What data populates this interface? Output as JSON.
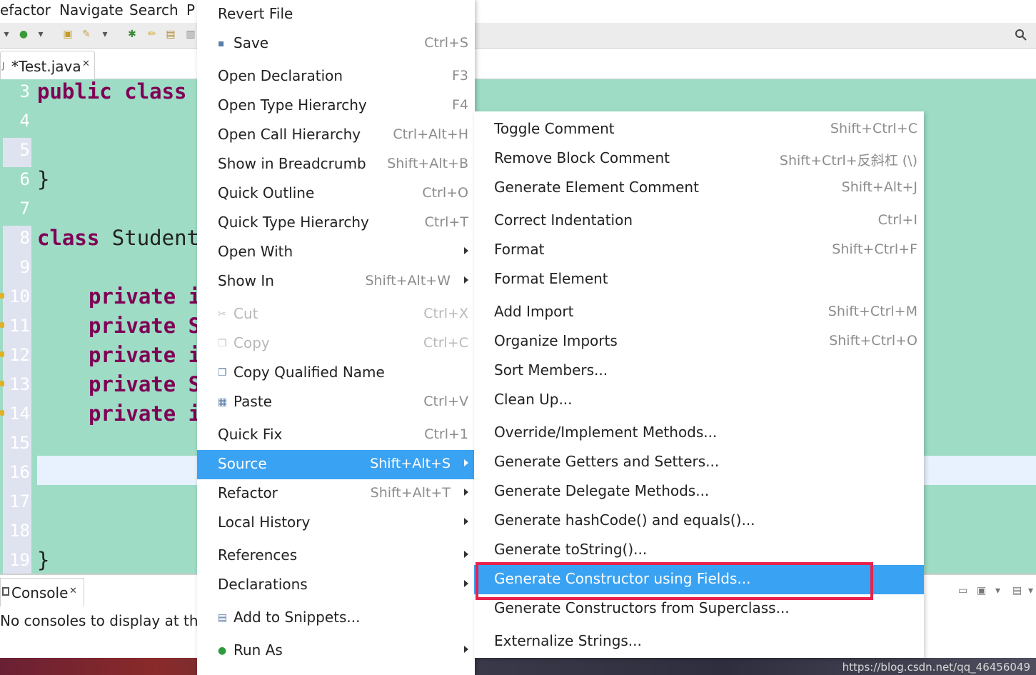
{
  "menubar": {
    "items": [
      "efactor",
      "Navigate",
      "Search",
      "P"
    ]
  },
  "toolbar": {
    "icons": [
      "dropdown-icon",
      "run-config-icon",
      "open-folder-icon",
      "wand-icon",
      "debug-icon",
      "pen-icon",
      "task-icon",
      "page-icon",
      "search-icon"
    ]
  },
  "editor": {
    "tab_title": "*Test.java",
    "lines": [
      {
        "num": "3",
        "text": "public class"
      },
      {
        "num": "4",
        "text": ""
      },
      {
        "num": "5",
        "text": ""
      },
      {
        "num": "6",
        "text": "}"
      },
      {
        "num": "7",
        "text": ""
      },
      {
        "num": "8",
        "text": "class Student"
      },
      {
        "num": "9",
        "text": ""
      },
      {
        "num": "10",
        "text": "private i"
      },
      {
        "num": "11",
        "text": "private S"
      },
      {
        "num": "12",
        "text": "private i"
      },
      {
        "num": "13",
        "text": "private S"
      },
      {
        "num": "14",
        "text": "private i"
      },
      {
        "num": "15",
        "text": ""
      },
      {
        "num": "16",
        "text": ""
      },
      {
        "num": "17",
        "text": ""
      },
      {
        "num": "18",
        "text": ""
      },
      {
        "num": "19",
        "text": "}"
      }
    ]
  },
  "console": {
    "tab_label": "Console",
    "message": "No consoles to display at this ti"
  },
  "context_menu": {
    "items": [
      {
        "label": "Revert File",
        "shortcut": ""
      },
      {
        "label": "Save",
        "shortcut": "Ctrl+S",
        "icon": "save-icon"
      },
      {
        "label": "Open Declaration",
        "shortcut": "F3"
      },
      {
        "label": "Open Type Hierarchy",
        "shortcut": "F4"
      },
      {
        "label": "Open Call Hierarchy",
        "shortcut": "Ctrl+Alt+H"
      },
      {
        "label": "Show in Breadcrumb",
        "shortcut": "Shift+Alt+B"
      },
      {
        "label": "Quick Outline",
        "shortcut": "Ctrl+O"
      },
      {
        "label": "Quick Type Hierarchy",
        "shortcut": "Ctrl+T"
      },
      {
        "label": "Open With",
        "shortcut": ""
      },
      {
        "label": "Show In",
        "shortcut": "Shift+Alt+W"
      },
      {
        "label": "Cut",
        "shortcut": "Ctrl+X",
        "icon": "cut-icon"
      },
      {
        "label": "Copy",
        "shortcut": "Ctrl+C",
        "icon": "copy-icon"
      },
      {
        "label": "Copy Qualified Name",
        "shortcut": "",
        "icon": "copy-qualified-icon"
      },
      {
        "label": "Paste",
        "shortcut": "Ctrl+V",
        "icon": "paste-icon"
      },
      {
        "label": "Quick Fix",
        "shortcut": "Ctrl+1"
      },
      {
        "label": "Source",
        "shortcut": "Shift+Alt+S"
      },
      {
        "label": "Refactor",
        "shortcut": "Shift+Alt+T"
      },
      {
        "label": "Local History",
        "shortcut": ""
      },
      {
        "label": "References",
        "shortcut": ""
      },
      {
        "label": "Declarations",
        "shortcut": ""
      },
      {
        "label": "Add to Snippets...",
        "shortcut": "",
        "icon": "snippet-icon"
      },
      {
        "label": "Run As",
        "shortcut": "",
        "icon": "run-icon"
      }
    ]
  },
  "source_submenu": {
    "items": [
      {
        "label": "Toggle Comment",
        "shortcut": "Shift+Ctrl+C"
      },
      {
        "label": "Remove Block Comment",
        "shortcut": "Shift+Ctrl+反斜杠 (\\)"
      },
      {
        "label": "Generate Element Comment",
        "shortcut": "Shift+Alt+J"
      },
      {
        "label": "Correct Indentation",
        "shortcut": "Ctrl+I"
      },
      {
        "label": "Format",
        "shortcut": "Shift+Ctrl+F"
      },
      {
        "label": "Format Element",
        "shortcut": ""
      },
      {
        "label": "Add Import",
        "shortcut": "Shift+Ctrl+M"
      },
      {
        "label": "Organize Imports",
        "shortcut": "Shift+Ctrl+O"
      },
      {
        "label": "Sort Members...",
        "shortcut": ""
      },
      {
        "label": "Clean Up...",
        "shortcut": ""
      },
      {
        "label": "Override/Implement Methods...",
        "shortcut": ""
      },
      {
        "label": "Generate Getters and Setters...",
        "shortcut": ""
      },
      {
        "label": "Generate Delegate Methods...",
        "shortcut": ""
      },
      {
        "label": "Generate hashCode() and equals()...",
        "shortcut": ""
      },
      {
        "label": "Generate toString()...",
        "shortcut": ""
      },
      {
        "label": "Generate Constructor using Fields...",
        "shortcut": ""
      },
      {
        "label": "Generate Constructors from Superclass...",
        "shortcut": ""
      },
      {
        "label": "Externalize Strings...",
        "shortcut": ""
      }
    ]
  },
  "watermark": "https://blog.csdn.net/qq_46456049",
  "colors": {
    "editor_bg": "#9edcc5",
    "keyword": "#7f0055",
    "menu_highlight": "#3aa2f2",
    "annotation_box": "#e8214d"
  }
}
